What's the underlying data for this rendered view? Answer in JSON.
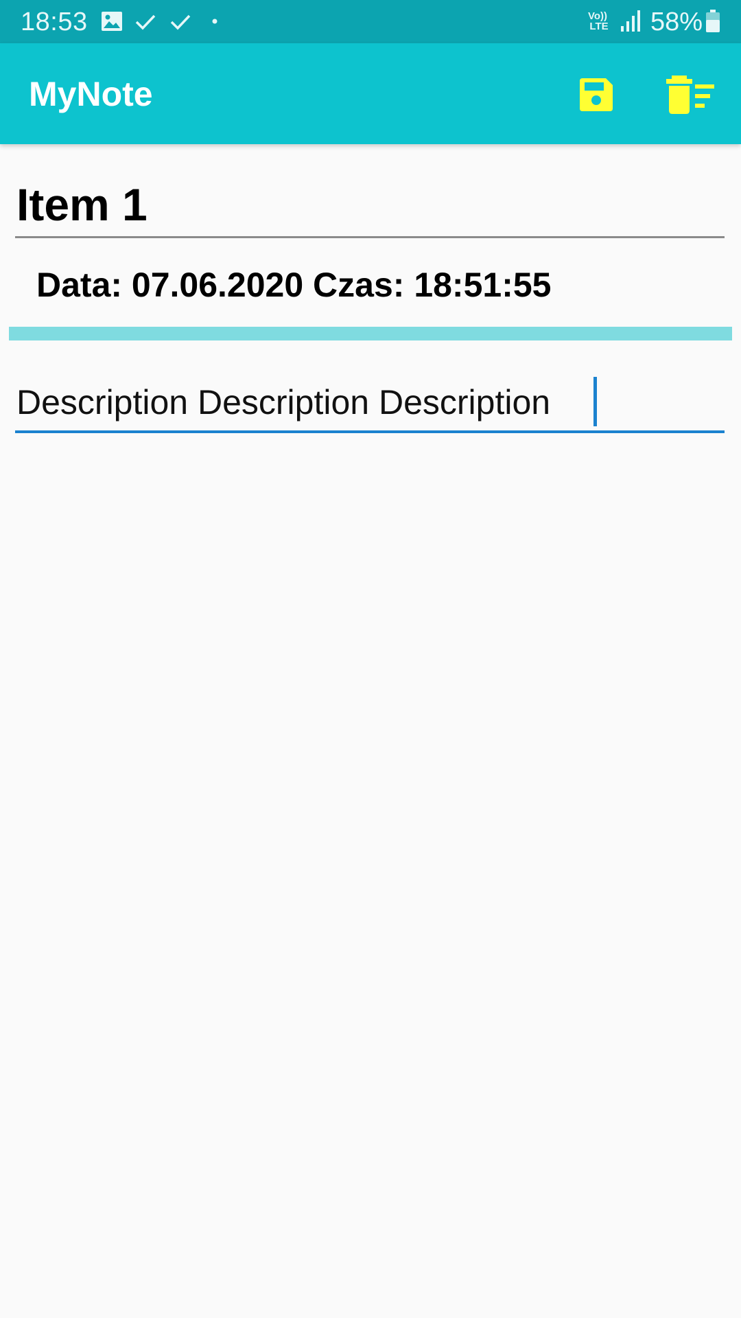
{
  "status_bar": {
    "time": "18:53",
    "network_label": "LTE",
    "battery": "58%",
    "icons": [
      "gallery-icon",
      "check-icon",
      "check-icon",
      "dot-icon",
      "volte-icon",
      "signal-icon",
      "battery-icon"
    ]
  },
  "app_bar": {
    "title": "MyNote",
    "background": "#0DC3CE",
    "actions": [
      {
        "icon": "save-icon",
        "color": "#FFFF33"
      },
      {
        "icon": "delete-sweep-icon",
        "color": "#FFFF33"
      }
    ]
  },
  "note": {
    "title": "Item 1",
    "datetime": "Data: 07.06.2020 Czas: 18:51:55",
    "description": "Description Description Description"
  },
  "colors": {
    "status_bar": "#0CA4B0",
    "accent": "#1B82CF",
    "divider": "#7FDBE0",
    "action_icon": "#FFFF33"
  }
}
